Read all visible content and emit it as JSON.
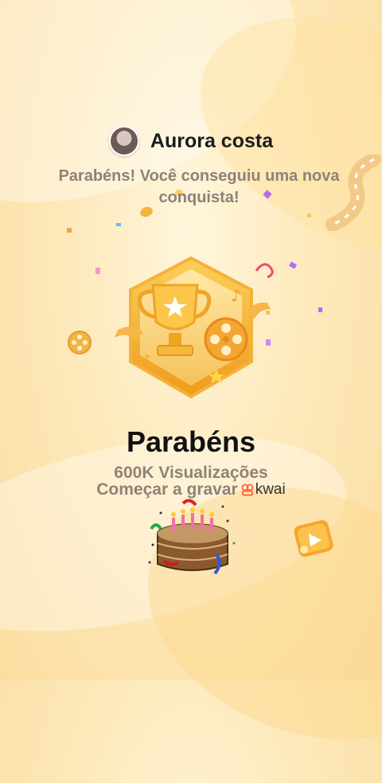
{
  "user": {
    "name": "Aurora costa"
  },
  "message": {
    "line1": "Parabéns! Você conseguiu uma nova",
    "line2": "conquista!"
  },
  "achievement": {
    "title": "Parabéns",
    "views": "600K Visualizações"
  },
  "cta": {
    "text": "Começar a gravar",
    "brand": "kwai"
  },
  "icons": {
    "avatar": "avatar",
    "badge": "trophy-badge-icon",
    "film_reel": "film-reel-icon",
    "cake": "birthday-cake-icon",
    "play": "play-icon"
  },
  "colors": {
    "background": "#fde9bb",
    "badge": "#f2a623",
    "brand": "#ff6a3d"
  }
}
